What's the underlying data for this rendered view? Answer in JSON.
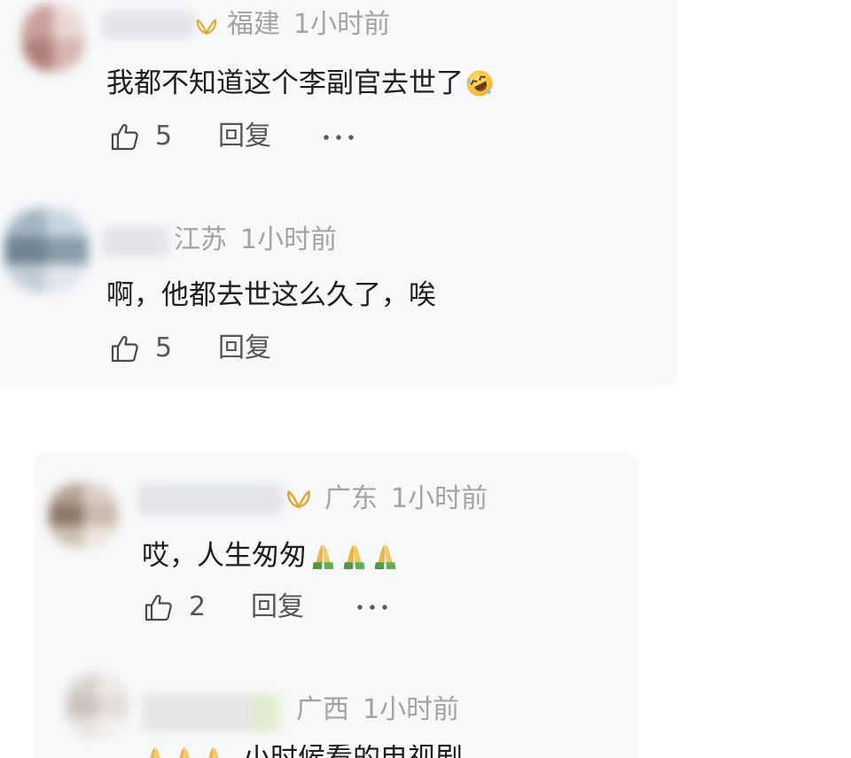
{
  "colors": {
    "page_bg": "#ffffff",
    "card_bg": "#f7f8fa",
    "meta_text": "#a3a3a3",
    "content_text": "#1e1e1e",
    "action_text": "#565656",
    "badge_gold": "#e3a530"
  },
  "icons": {
    "like": "thumbs-up-icon",
    "more": "more-icon",
    "badge": "vip-butterfly-icon"
  },
  "comments": [
    {
      "badge": true,
      "location": "福建",
      "time": "1小时前",
      "text": "我都不知道这个李副官去世了",
      "emojis": [
        "laugh-cry-emoji"
      ],
      "likes": "5",
      "reply_label": "回复",
      "more": true
    },
    {
      "badge": false,
      "location": "江苏",
      "time": "1小时前",
      "text": "啊，他都去世这么久了，唉",
      "emojis": [],
      "likes": "5",
      "reply_label": "回复",
      "more": false
    },
    {
      "badge": true,
      "location": "广东",
      "time": "1小时前",
      "text": "哎，人生匆匆",
      "emojis": [
        "pray-emoji",
        "pray-emoji",
        "pray-emoji"
      ],
      "likes": "2",
      "reply_label": "回复",
      "more": true
    },
    {
      "badge": false,
      "location": "广西",
      "time": "1小时前",
      "leading_emojis": [
        "pray-emoji",
        "pray-emoji",
        "pray-emoji"
      ],
      "text": "小时候看的电视剧"
    }
  ]
}
